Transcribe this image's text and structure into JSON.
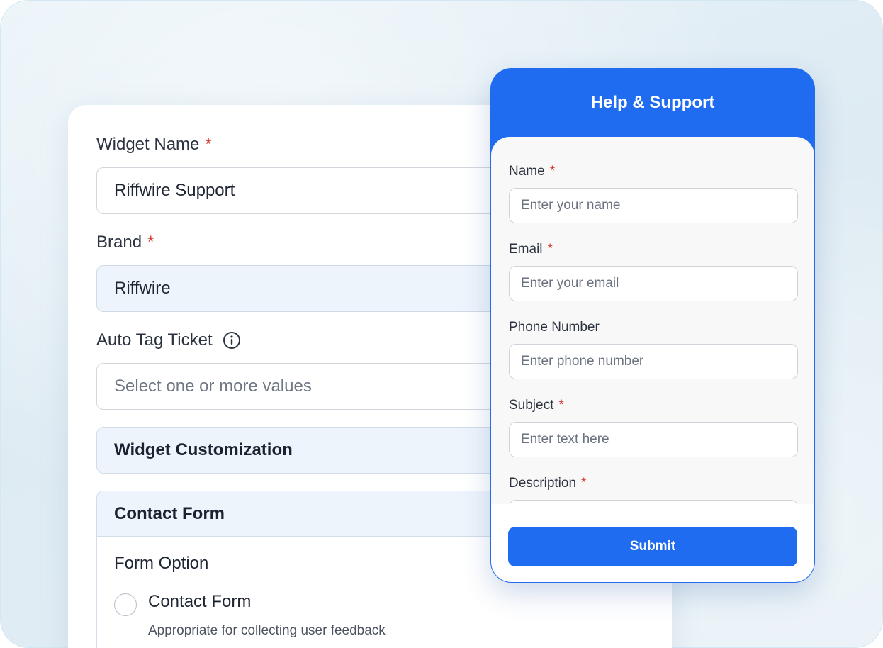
{
  "settings": {
    "widget_name": {
      "label": "Widget Name",
      "required_mark": "*",
      "value": "Riffwire Support"
    },
    "brand": {
      "label": "Brand",
      "required_mark": "*",
      "value": "Riffwire"
    },
    "auto_tag": {
      "label": "Auto Tag Ticket",
      "icon": "info-icon",
      "placeholder": "Select one or more values"
    },
    "widget_customization": {
      "label": "Widget Customization"
    },
    "contact_form": {
      "label": "Contact Form",
      "form_option_title": "Form Option",
      "option": {
        "label": "Contact Form",
        "description": "Appropriate for collecting user feedback",
        "selected": false
      }
    }
  },
  "help_widget": {
    "title": "Help & Support",
    "fields": {
      "name": {
        "label": "Name",
        "required_mark": "*",
        "placeholder": "Enter your name"
      },
      "email": {
        "label": "Email",
        "required_mark": "*",
        "placeholder": "Enter your email"
      },
      "phone": {
        "label": "Phone Number",
        "placeholder": "Enter phone number"
      },
      "subject": {
        "label": "Subject",
        "required_mark": "*",
        "placeholder": "Enter text here"
      },
      "description": {
        "label": "Description",
        "required_mark": "*"
      }
    },
    "submit_label": "Submit"
  },
  "colors": {
    "accent": "#1f6cf0",
    "required": "#d63d2f",
    "filled_field": "#eef4fc"
  }
}
